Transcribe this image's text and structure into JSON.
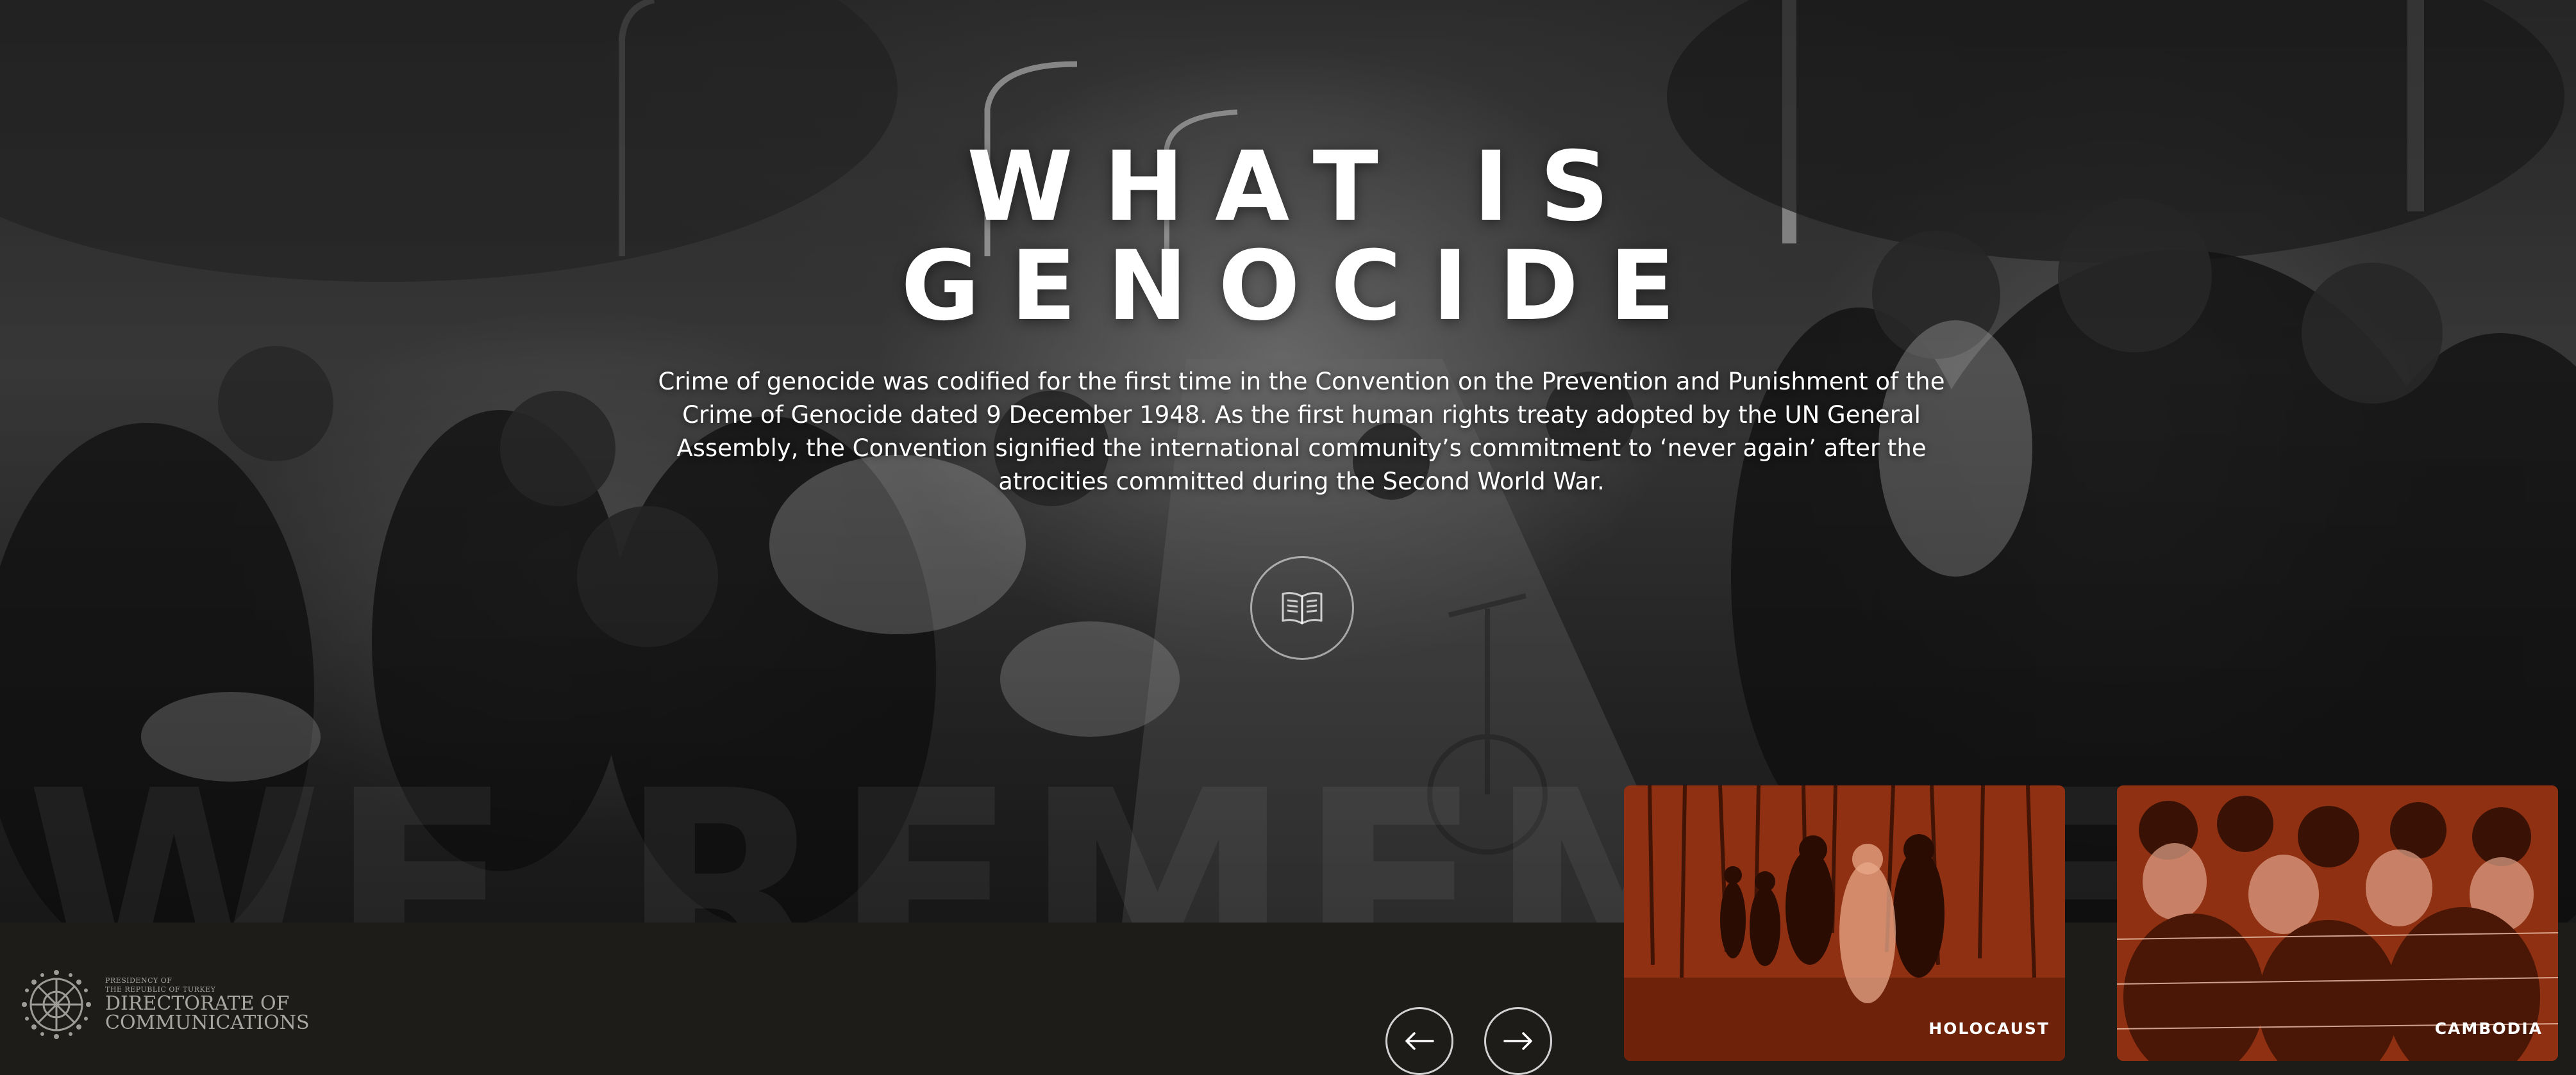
{
  "hero": {
    "title_line1": "WHAT IS",
    "title_line2": "GENOCIDE",
    "description": "Crime of genocide was codified for the first time in the Convention on the Prevention and Punishment of the Crime of Genocide dated 9 December 1948. As the first human rights treaty adopted by the UN General Assembly, the Convention signified the international community’s commitment to ‘never again’ after the atrocities committed during the Second World War.",
    "read_icon": "book-icon",
    "watermark": "WE REMEMBER"
  },
  "logo": {
    "line1": "PRESIDENCY OF",
    "line2": "THE REPUBLIC OF TURKEY",
    "line3": "DIRECTORATE OF",
    "line4": "COMMUNICATIONS"
  },
  "nav": {
    "prev_icon": "arrow-left-icon",
    "next_icon": "arrow-right-icon"
  },
  "cards": [
    {
      "label": "HOLOCAUST"
    },
    {
      "label": "CAMBODIA"
    }
  ],
  "colors": {
    "card_tint": "#8a2e10",
    "footer_bg": "#1d1c19"
  }
}
